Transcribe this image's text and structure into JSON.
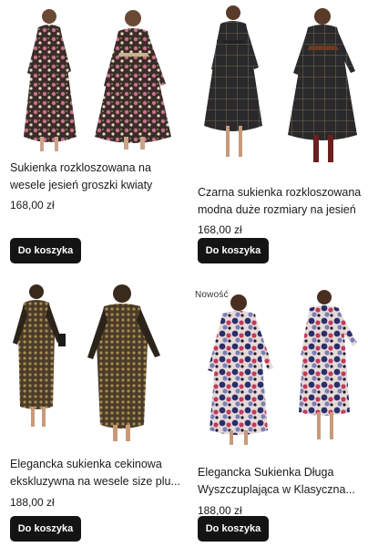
{
  "products": [
    {
      "title_lines": [
        "Sukienka rozkloszowana na",
        "wesele jesień groszki kwiaty"
      ],
      "price": "168,00 zł",
      "button": "Do koszyka",
      "badge": ""
    },
    {
      "title_lines": [
        "Czarna sukienka rozkloszowana",
        "modna duże rozmiary na jesień"
      ],
      "price": "168,00 zł",
      "button": "Do koszyka",
      "badge": ""
    },
    {
      "title_lines": [
        "Elegancka sukienka cekinowa",
        "ekskluzywna na wesele size plu..."
      ],
      "price": "188,00 zł",
      "button": "Do koszyka",
      "badge": ""
    },
    {
      "title_lines": [
        "Elegancka Sukienka Długa",
        "Wyszczuplająca w Klasyczna..."
      ],
      "price": "188,00 zł",
      "button": "Do koszyka",
      "badge": "Nowość"
    }
  ],
  "colors": {
    "button_bg": "#141414",
    "button_text": "#ffffff",
    "text": "#1a1a1a"
  }
}
